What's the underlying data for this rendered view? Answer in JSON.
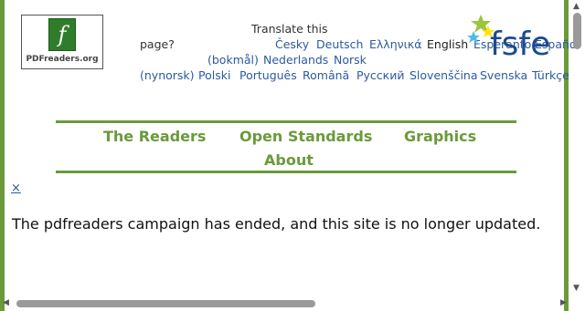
{
  "logo": {
    "glyph": "f",
    "text": "PDFreaders.org"
  },
  "translate": {
    "line1": "Translate this",
    "line2": "page?",
    "languages": {
      "cesky": "Česky",
      "deutsch": "Deutsch",
      "ellinika": "Ελληνικά",
      "english": "English",
      "esperanto": "Esperanto",
      "espanol": "Español",
      "bokmal": "(bokmål)",
      "nederlands": "Nederlands",
      "norsk": "Norsk",
      "nynorsk": "(nynorsk)",
      "polski": "Polski",
      "portugues": "Português",
      "romana": "Română",
      "russkiy": "Русский",
      "slovenscina": "Slovenščina",
      "svenska": "Svenska",
      "turkce": "Türkçe"
    }
  },
  "fsfe": {
    "text": "fsfe",
    "colors": {
      "green": "#9bc53d",
      "yellow": "#ffe400",
      "blue": "#4cbbe9",
      "text": "#1c4b8c"
    }
  },
  "nav": {
    "the_readers": "The Readers",
    "open_standards": "Open Standards",
    "graphics": "Graphics",
    "about": "About"
  },
  "close_label": "×",
  "notice": "The pdfreaders campaign has ended, and this site is no longer updated.",
  "colors": {
    "accent_green": "#6a9a3a",
    "link_blue": "#2c5aa0"
  }
}
